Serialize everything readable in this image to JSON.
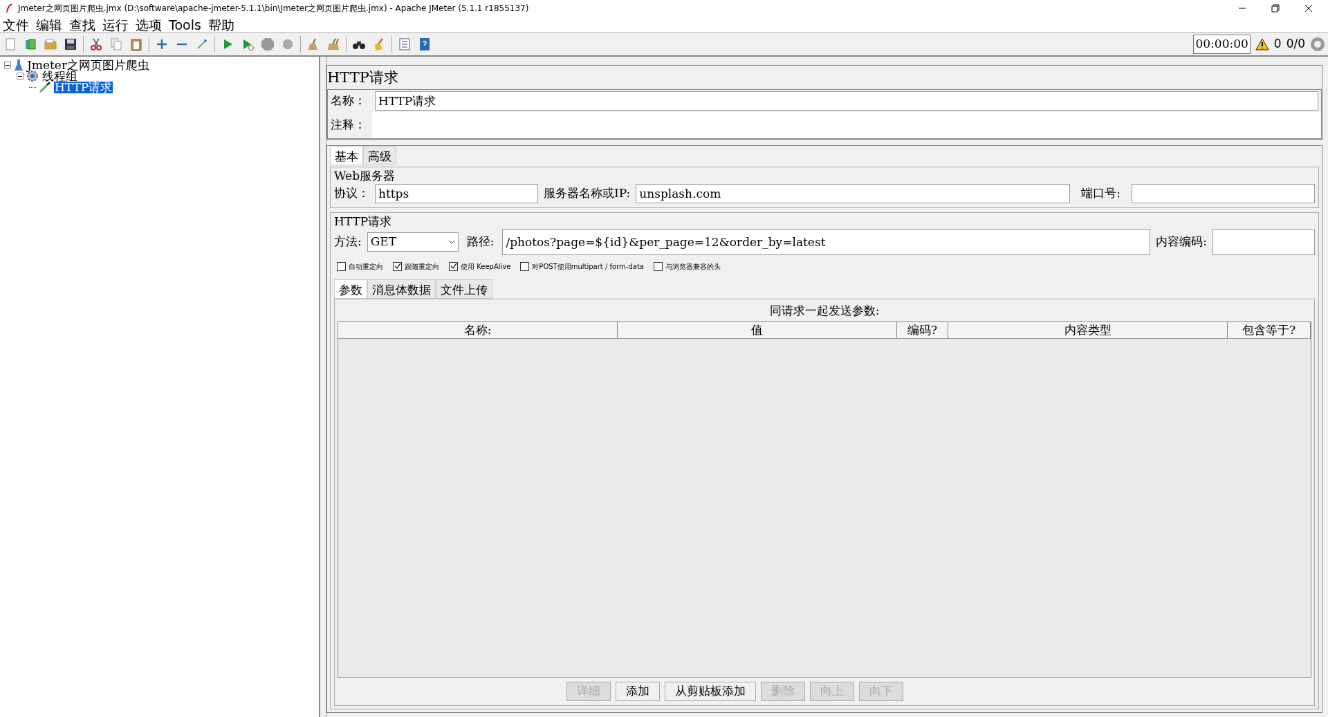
{
  "window": {
    "title": "Jmeter之网页图片爬虫.jmx (D:\\software\\apache-jmeter-5.1.1\\bin\\Jmeter之网页图片爬虫.jmx) - Apache JMeter (5.1.1 r1855137)"
  },
  "menu": [
    "文件",
    "编辑",
    "查找",
    "运行",
    "选项",
    "Tools",
    "帮助"
  ],
  "status": {
    "timer": "00:00:00",
    "warnings": "0",
    "threads": "0/0"
  },
  "tree": [
    {
      "label": "Jmeter之网页图片爬虫",
      "selected": false,
      "expanded": true,
      "kind": "plan",
      "children": [
        {
          "label": "线程组",
          "selected": false,
          "expanded": true,
          "kind": "group",
          "children": [
            {
              "label": "HTTP请求",
              "selected": true,
              "kind": "sampler"
            }
          ]
        }
      ]
    }
  ],
  "panel": {
    "title": "HTTP请求",
    "name_label": "名称：",
    "name_value": "HTTP请求",
    "comments_label": "注释："
  },
  "tabs": [
    {
      "label": "基本",
      "selected": true
    },
    {
      "label": "高级",
      "selected": false
    }
  ],
  "web_server": {
    "legend": "Web服务器",
    "protocol_label": "协议：",
    "protocol": "https",
    "server_label": "服务器名称或IP:",
    "server": "unsplash.com",
    "port_label": "端口号:"
  },
  "http_request": {
    "legend": "HTTP请求",
    "method_label": "方法:",
    "method": "GET",
    "path_label": "路径:",
    "path": "/photos?page=${id}&per_page=12&order_by=latest",
    "encoding_label": "内容编码:"
  },
  "options": [
    {
      "label": "自动重定向",
      "checked": false
    },
    {
      "label": "跟随重定向",
      "checked": true
    },
    {
      "label": "使用 KeepAlive",
      "checked": true
    },
    {
      "label": "对POST使用multipart / form-data",
      "checked": false
    },
    {
      "label": "与浏览器兼容的头",
      "checked": false
    }
  ],
  "param_tabs": [
    {
      "label": "参数",
      "selected": true
    },
    {
      "label": "消息体数据",
      "selected": false
    },
    {
      "label": "文件上传",
      "selected": false
    }
  ],
  "params": {
    "caption": "同请求一起发送参数:",
    "columns": [
      "名称:",
      "值",
      "编码?",
      "内容类型",
      "包含等于?"
    ]
  },
  "buttons": [
    {
      "label": "详细",
      "disabled": true
    },
    {
      "label": "添加",
      "disabled": false
    },
    {
      "label": "从剪贴板添加",
      "disabled": false
    },
    {
      "label": "删除",
      "disabled": true
    },
    {
      "label": "向上",
      "disabled": true
    },
    {
      "label": "向下",
      "disabled": true
    }
  ]
}
